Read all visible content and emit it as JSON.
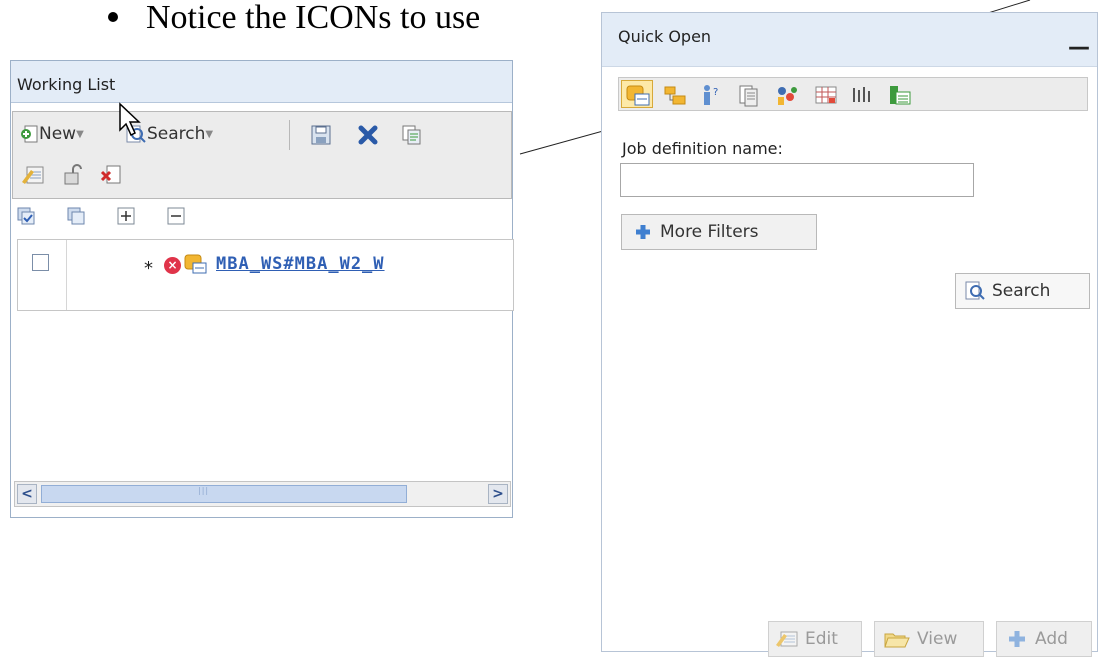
{
  "slide": {
    "bullet_text": "Notice the ICONs to use"
  },
  "working_list": {
    "title": "Working List",
    "toolbar": {
      "new_label": "New",
      "search_label": "Search"
    },
    "rows": [
      {
        "marker": "*",
        "link_text": "MBA_WS#MBA_W2_W"
      }
    ],
    "scrollbar": {
      "grip": "|||"
    }
  },
  "quick_open": {
    "title": "Quick Open",
    "minimize_label": "—",
    "field": {
      "label": "Job definition name:",
      "value": "",
      "placeholder": ""
    },
    "more_filters_label": "More Filters",
    "search_label": "Search",
    "footer": {
      "edit_label": "Edit",
      "view_label": "View",
      "add_label": "Add"
    }
  },
  "icons": {
    "toolbar": [
      "new-icon",
      "search-icon",
      "save-icon",
      "delete-icon",
      "copy-icon",
      "edit-icon",
      "unlock-icon",
      "remove-icon"
    ],
    "tree": [
      "select-all-icon",
      "copy-rows-icon",
      "expand-icon",
      "collapse-icon"
    ],
    "quick_open": [
      "job-definition-icon",
      "job-stream-icon",
      "workstation-icon",
      "calendar-icon",
      "prompt-icon",
      "resource-icon",
      "variable-table-icon",
      "run-cycle-icon"
    ]
  },
  "colors": {
    "panel_header": "#e3ecf7",
    "link": "#2f5fb4",
    "error": "#e0344a",
    "selected_icon_bg": "#fde9a8"
  }
}
